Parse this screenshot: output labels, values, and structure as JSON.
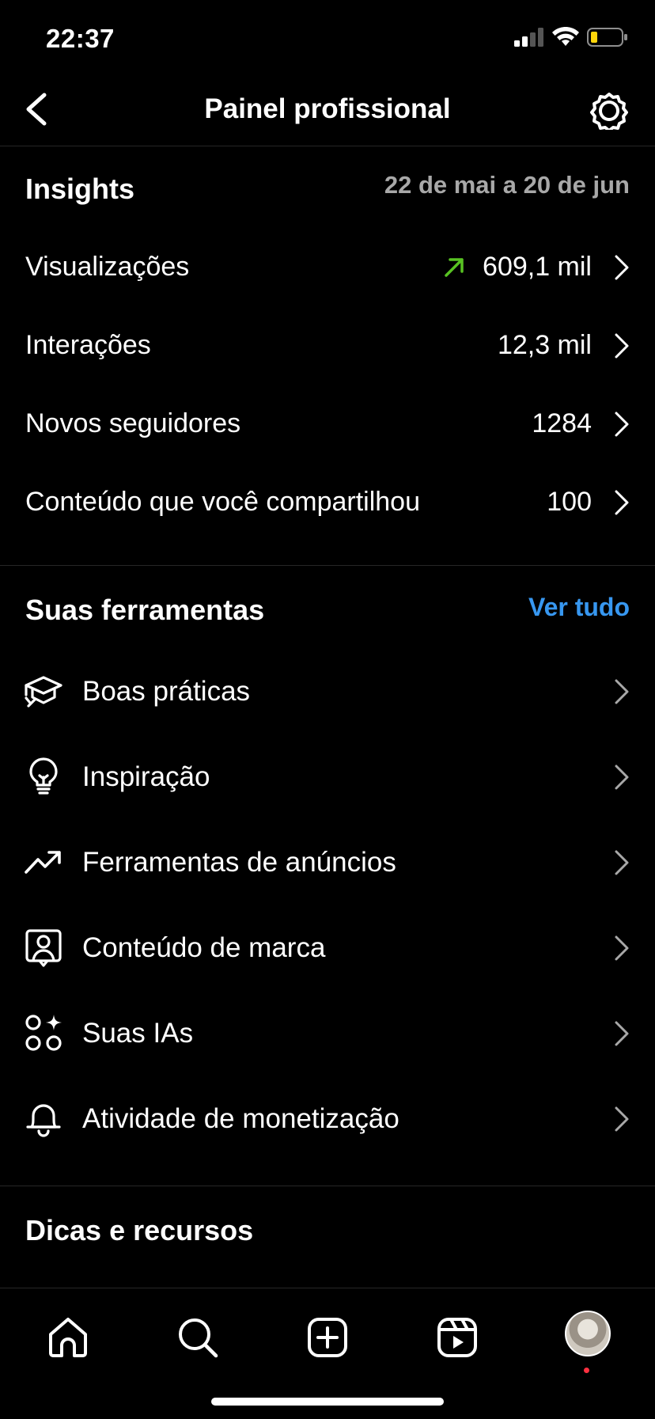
{
  "status_bar": {
    "time": "22:37"
  },
  "header": {
    "title": "Painel profissional"
  },
  "insights": {
    "title": "Insights",
    "date_range": "22 de mai a 20 de jun",
    "metrics": [
      {
        "label": "Visualizações",
        "value": "609,1 mil",
        "trend": "up"
      },
      {
        "label": "Interações",
        "value": "12,3 mil"
      },
      {
        "label": "Novos seguidores",
        "value": "1284"
      },
      {
        "label": "Conteúdo que você compartilhou",
        "value": "100"
      }
    ]
  },
  "tools": {
    "title": "Suas ferramentas",
    "see_all": "Ver tudo",
    "items": [
      {
        "label": "Boas práticas",
        "icon": "graduation-cap-icon"
      },
      {
        "label": "Inspiração",
        "icon": "lightbulb-icon"
      },
      {
        "label": "Ferramentas de anúncios",
        "icon": "trending-up-icon"
      },
      {
        "label": "Conteúdo de marca",
        "icon": "branded-content-icon"
      },
      {
        "label": "Suas IAs",
        "icon": "ai-sparkle-icon"
      },
      {
        "label": "Atividade de monetização",
        "icon": "bell-icon"
      }
    ]
  },
  "tips": {
    "title": "Dicas e recursos"
  },
  "colors": {
    "accent": "#3797f0",
    "trend_up": "#58c322",
    "muted": "#a8a8a8",
    "notification": "#ff3040"
  }
}
